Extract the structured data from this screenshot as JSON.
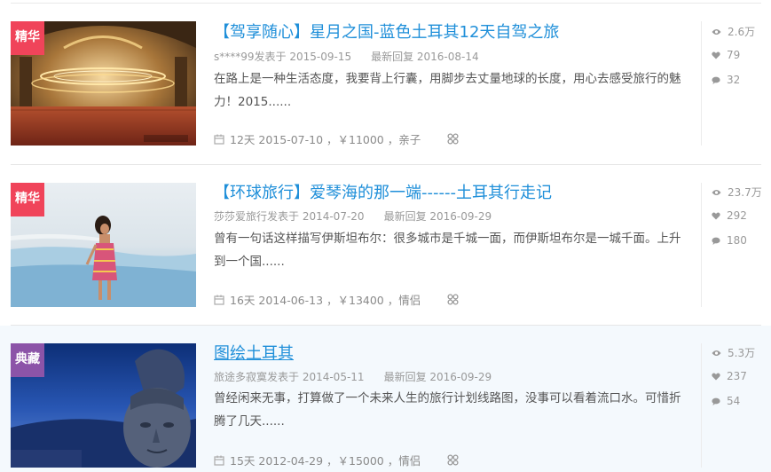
{
  "posts": [
    {
      "badge": "精华",
      "title": "【驾享随心】星月之国-蓝色土耳其12天自驾之旅",
      "author_posted": "s****99发表于 2015-09-15",
      "last_reply": "最新回复 2016-08-14",
      "description": "在路上是一种生活态度，我要背上行囊，用脚步去丈量地球的长度，用心去感受旅行的魅力！2015......",
      "info": "12天 2015-07-10 ，￥11000 ，亲子",
      "views": "2.6万",
      "likes": "79",
      "comments": "32",
      "thumbnail": "mosque-interior-photo"
    },
    {
      "badge": "精华",
      "title": "【环球旅行】爱琴海的那一端------土耳其行走记",
      "author_posted": "莎莎爱旅行发表于 2014-07-20",
      "last_reply": "最新回复 2016-09-29",
      "description": "曾有一句话这样描写伊斯坦布尔：很多城市是千城一面，而伊斯坦布尔是一城千面。上升到一个国......",
      "info": "16天 2014-06-13 ，￥13400 ，情侣",
      "views": "23.7万",
      "likes": "292",
      "comments": "180",
      "thumbnail": "woman-on-travertine-terraces-photo"
    },
    {
      "badge": "典藏",
      "title": "图绘土耳其",
      "author_posted": "旅途多寂寞发表于 2014-05-11",
      "last_reply": "最新回复 2016-09-29",
      "description": "曾经闲来无事，打算做了一个未来人生的旅行计划线路图，没事可以看着流口水。可惜折腾了几天......",
      "info": "15天 2012-04-29 ，￥15000 ，情侣",
      "views": "5.3万",
      "likes": "237",
      "comments": "54",
      "thumbnail": "stone-head-statue-photo"
    }
  ],
  "icons": {
    "views": "eye-icon",
    "likes": "heart-icon",
    "comments": "comment-icon",
    "date": "calendar-icon",
    "share": "share-icon"
  },
  "colors": {
    "title": "#1f8fd9",
    "badge_essence": "#f0445a",
    "badge_collection": "#8c54a8",
    "highlight_row": "#f4f9fd"
  }
}
